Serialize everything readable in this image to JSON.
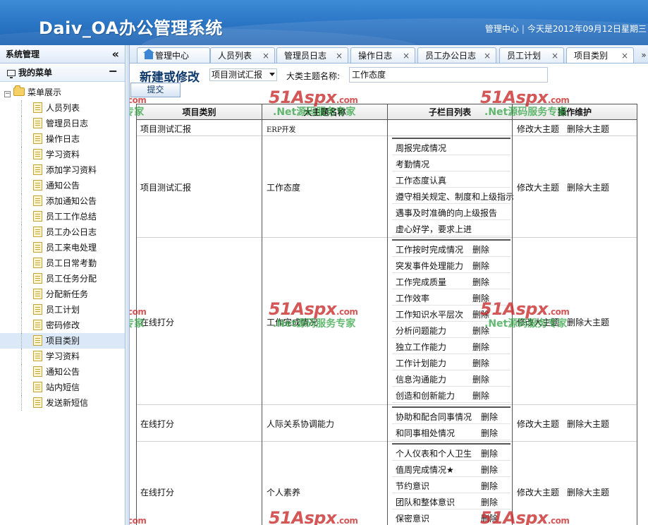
{
  "header": {
    "title": "Daiv_OA办公管理系统",
    "admin_link": "管理中心",
    "separator": "|",
    "date_text": "今天是2012年09月12日星期三"
  },
  "sidebar": {
    "title": "系统管理",
    "collapse_glyph": "«",
    "my_menu": "我的菜单",
    "my_menu_toggle": "−",
    "root_toggle": "−",
    "root_label": "菜单展示",
    "items": [
      {
        "label": "人员列表"
      },
      {
        "label": "管理员日志"
      },
      {
        "label": "操作日志"
      },
      {
        "label": "学习资料"
      },
      {
        "label": "添加学习资料"
      },
      {
        "label": "通知公告"
      },
      {
        "label": "添加通知公告"
      },
      {
        "label": "员工工作总结"
      },
      {
        "label": "员工办公日志"
      },
      {
        "label": "员工来电处理"
      },
      {
        "label": "员工日常考勤"
      },
      {
        "label": "员工任务分配"
      },
      {
        "label": "分配新任务"
      },
      {
        "label": "员工计划"
      },
      {
        "label": "密码修改"
      },
      {
        "label": "项目类别"
      },
      {
        "label": "学习资料"
      },
      {
        "label": "通知公告"
      },
      {
        "label": "站内短信"
      },
      {
        "label": "发送新短信"
      }
    ],
    "active_index": 15
  },
  "tabs": [
    {
      "label": "管理中心",
      "closable": false
    },
    {
      "label": "人员列表",
      "closable": true
    },
    {
      "label": "管理员日志",
      "closable": true
    },
    {
      "label": "操作日志",
      "closable": true
    },
    {
      "label": "员工办公日志",
      "closable": true
    },
    {
      "label": "员工计划",
      "closable": true
    },
    {
      "label": "项目类别",
      "closable": true
    }
  ],
  "tab_close_glyph": "×",
  "tab_scroll_glyph": "»",
  "form": {
    "title": "新建或修改",
    "project_select_value": "项目测试汇报",
    "category_label": "大类主题名称:",
    "category_value": "工作态度",
    "submit_label": "提交"
  },
  "grid": {
    "headers": [
      "项目类别",
      "大主题名称",
      "子栏目列表",
      "操作维护"
    ],
    "edit_label": "修改大主题",
    "delete_label": "删除大主题",
    "sub_delete_label": "删除",
    "rows": [
      {
        "category": "项目测试汇报",
        "topic": "ERP开发",
        "subs": [],
        "show_sub_delete": false
      },
      {
        "category": "项目测试汇报",
        "topic": "工作态度",
        "show_sub_delete": false,
        "subs": [
          "周报完成情况",
          "考勤情况",
          "工作态度认真",
          "遵守相关规定、制度和上级指示",
          "遇事及时准确的向上级报告",
          "虚心好学，要求上进"
        ]
      },
      {
        "category": "在线打分",
        "topic": "工作完成情况",
        "show_sub_delete": true,
        "subs": [
          "工作按时完成情况",
          "突发事件处理能力",
          "工作完成质量",
          "工作效率",
          "工作知识水平层次",
          "分析问题能力",
          "独立工作能力",
          "工作计划能力",
          "信息沟通能力",
          "创造和创新能力"
        ]
      },
      {
        "category": "在线打分",
        "topic": "人际关系协调能力",
        "show_sub_delete": true,
        "subs": [
          "协助和配合同事情况",
          "和同事相处情况"
        ]
      },
      {
        "category": "在线打分",
        "topic": "个人素养",
        "show_sub_delete": true,
        "subs": [
          "个人仪表和个人卫生",
          "值周完成情况★",
          "节约意识",
          "团队和整体意识",
          "保密意识"
        ]
      }
    ]
  },
  "watermark": {
    "logo": "51Aspx",
    "domain": ".com",
    "tagline": ".Net源码服务专家"
  }
}
